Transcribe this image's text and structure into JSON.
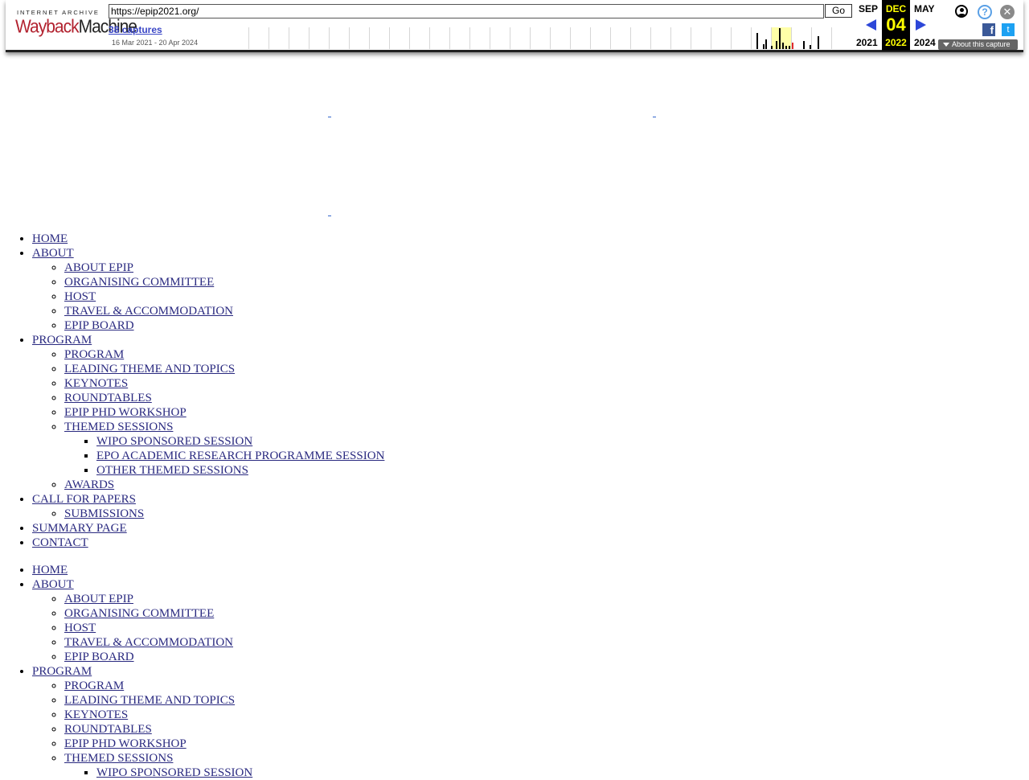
{
  "wayback": {
    "logo_top": "INTERNET ARCHIVE",
    "logo_main_a": "Wayback",
    "logo_main_b": "Machine",
    "url": "https://epip2021.org/",
    "go_label": "Go",
    "captures": "38 captures",
    "date_range": "16 Mar 2021 - 20 Apr 2024",
    "prev_month": "SEP",
    "current_month": "DEC",
    "next_month": "MAY",
    "prev_year": "2021",
    "current_day": "04",
    "current_year": "2022",
    "next_year": "2024",
    "about_label": "About this capture",
    "help_glyph": "?",
    "close_glyph": "✕",
    "facebook_glyph": "f",
    "twitter_glyph": "t"
  },
  "menu_primary": [
    {
      "label": "HOME"
    },
    {
      "label": "ABOUT",
      "children": [
        {
          "label": "ABOUT EPIP"
        },
        {
          "label": "ORGANISING COMMITTEE"
        },
        {
          "label": "HOST"
        },
        {
          "label": "TRAVEL & ACCOMMODATION"
        },
        {
          "label": "EPIP BOARD"
        }
      ]
    },
    {
      "label": "PROGRAM",
      "children": [
        {
          "label": "PROGRAM"
        },
        {
          "label": "LEADING THEME AND TOPICS"
        },
        {
          "label": "KEYNOTES"
        },
        {
          "label": "ROUNDTABLES"
        },
        {
          "label": "EPIP PHD WORKSHOP"
        },
        {
          "label": "THEMED SESSIONS",
          "children": [
            {
              "label": "WIPO SPONSORED SESSION"
            },
            {
              "label": "EPO ACADEMIC RESEARCH PROGRAMME SESSION"
            },
            {
              "label": "OTHER THEMED SESSIONS"
            }
          ]
        },
        {
          "label": "AWARDS"
        }
      ]
    },
    {
      "label": "CALL FOR PAPERS",
      "children": [
        {
          "label": "SUBMISSIONS"
        }
      ]
    },
    {
      "label": "SUMMARY PAGE"
    },
    {
      "label": "CONTACT"
    }
  ],
  "menu_secondary": [
    {
      "label": "HOME"
    },
    {
      "label": "ABOUT",
      "children": [
        {
          "label": "ABOUT EPIP"
        },
        {
          "label": "ORGANISING COMMITTEE"
        },
        {
          "label": "HOST"
        },
        {
          "label": "TRAVEL & ACCOMMODATION"
        },
        {
          "label": "EPIP BOARD"
        }
      ]
    },
    {
      "label": "PROGRAM",
      "children": [
        {
          "label": "PROGRAM"
        },
        {
          "label": "LEADING THEME AND TOPICS"
        },
        {
          "label": "KEYNOTES"
        },
        {
          "label": "ROUNDTABLES"
        },
        {
          "label": "EPIP PHD WORKSHOP"
        },
        {
          "label": "THEMED SESSIONS",
          "children": [
            {
              "label": "WIPO SPONSORED SESSION"
            }
          ]
        }
      ]
    }
  ]
}
